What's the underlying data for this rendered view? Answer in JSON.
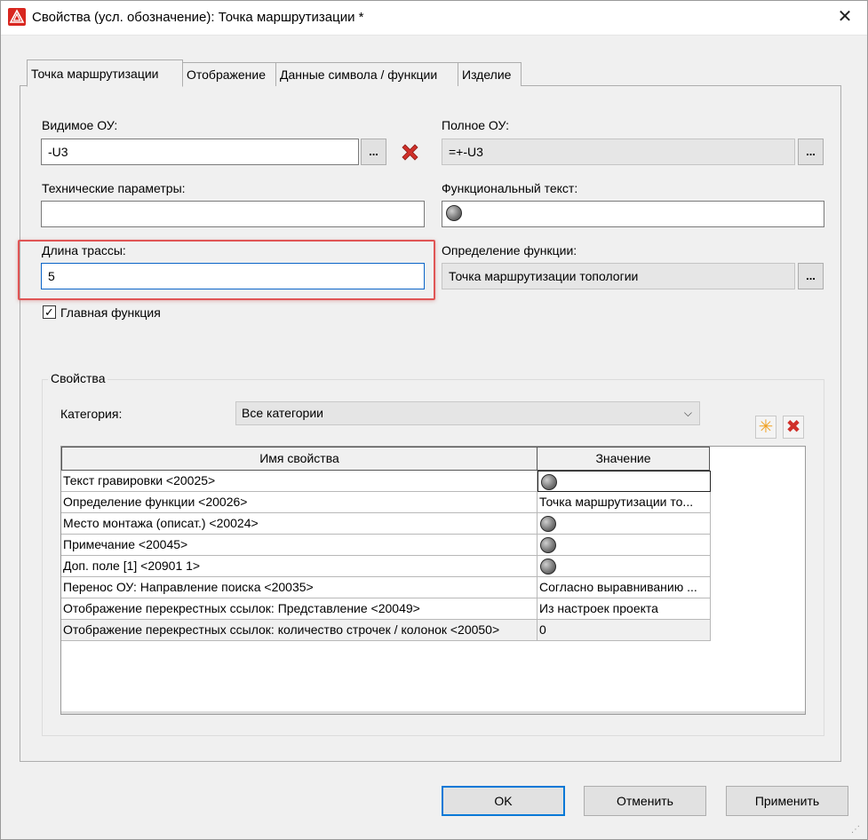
{
  "window": {
    "title": "Свойства (усл. обозначение): Точка маршрутизации *",
    "close_glyph": "✕"
  },
  "tabs": [
    {
      "label": "Точка маршрутизации",
      "active": true
    },
    {
      "label": "Отображение"
    },
    {
      "label": "Данные символа / функции"
    },
    {
      "label": "Изделие"
    }
  ],
  "fields": {
    "visible_ou": {
      "label": "Видимое ОУ:",
      "value": "-U3"
    },
    "full_ou": {
      "label": "Полное ОУ:",
      "value": "=+-U3"
    },
    "tech_params": {
      "label": "Технические параметры:",
      "value": ""
    },
    "func_text": {
      "label": "Функциональный текст:",
      "value": ""
    },
    "route_length": {
      "label": "Длина трассы:",
      "value": "5"
    },
    "func_def": {
      "label": "Определение функции:",
      "value": "Точка маршрутизации топологии"
    },
    "dots": "..."
  },
  "main_function": {
    "label": "Главная функция",
    "checked": true,
    "check_glyph": "✓"
  },
  "properties": {
    "group_title": "Свойства",
    "category_label": "Категория:",
    "category_value": "Все категории",
    "combo_arrow": "⌵",
    "new_glyph": "✳",
    "delete_glyph": "✖",
    "columns": [
      "Имя свойства",
      "Значение"
    ],
    "rows": [
      {
        "name": "Текст гравировки <20025>",
        "value": "",
        "globe": true
      },
      {
        "name": "Определение функции <20026>",
        "value": "Точка маршрутизации то...",
        "globe": false
      },
      {
        "name": "Место монтажа (описат.) <20024>",
        "value": "",
        "globe": true
      },
      {
        "name": "Примечание <20045>",
        "value": "",
        "globe": true
      },
      {
        "name": "Доп. поле [1] <20901 1>",
        "value": "",
        "globe": true
      },
      {
        "name": "Перенос ОУ: Направление поиска <20035>",
        "value": "Согласно выравниванию ...",
        "globe": false
      },
      {
        "name": "Отображение перекрестных ссылок: Представление <20049>",
        "value": "Из настроек проекта",
        "globe": false
      },
      {
        "name": "Отображение перекрестных ссылок: количество строчек / колонок <20050>",
        "value": "0",
        "globe": false
      }
    ]
  },
  "buttons": {
    "ok": "OK",
    "cancel": "Отменить",
    "apply": "Применить"
  },
  "colors": {
    "highlight": "#e05555",
    "delete_red": "#d0302a",
    "new_orange": "#f0a020",
    "focus_blue": "#0a64c8"
  }
}
